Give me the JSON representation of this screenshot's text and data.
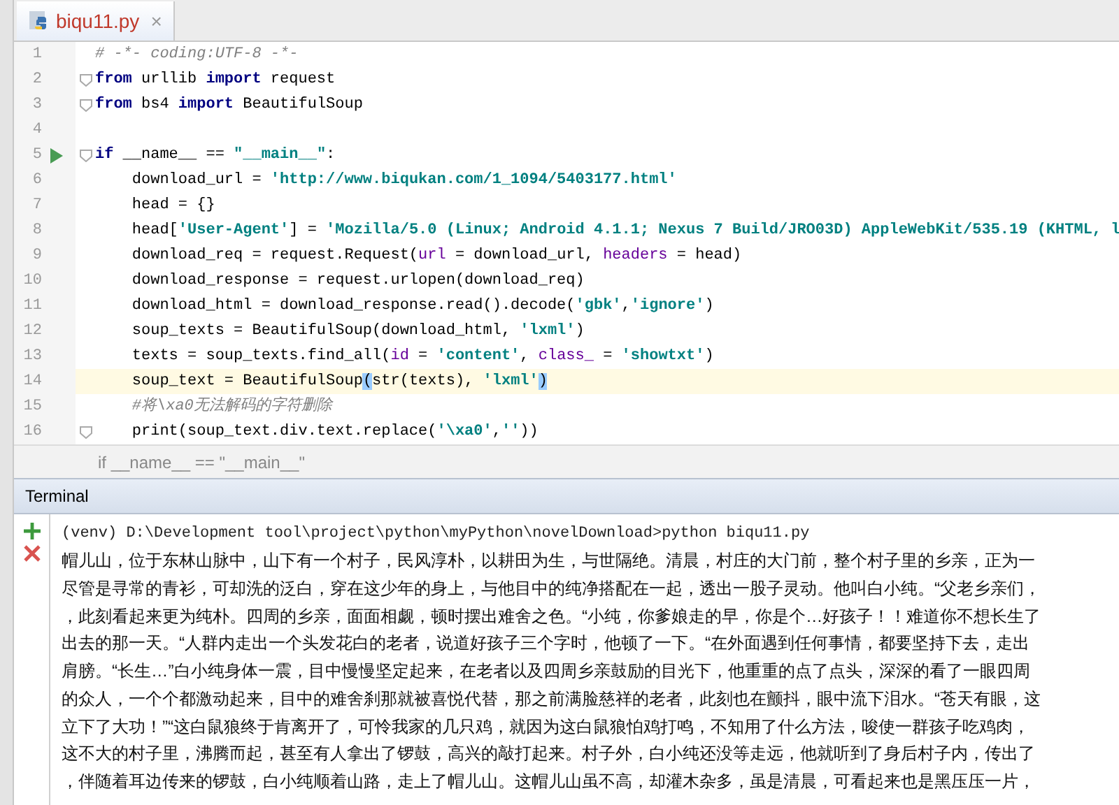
{
  "tab": {
    "title": "biqu11.py",
    "close": "×"
  },
  "code_lines": [
    {
      "number": "1",
      "current": false,
      "run": false,
      "fold": false,
      "tokens": [
        {
          "kind": "cmt",
          "text": "# -*- coding:UTF-8 -*-"
        }
      ]
    },
    {
      "number": "2",
      "current": false,
      "run": false,
      "fold": true,
      "tokens": [
        {
          "kind": "kw",
          "text": "from"
        },
        {
          "kind": "plain",
          "text": " urllib "
        },
        {
          "kind": "kw",
          "text": "import"
        },
        {
          "kind": "plain",
          "text": " request"
        }
      ]
    },
    {
      "number": "3",
      "current": false,
      "run": false,
      "fold": true,
      "tokens": [
        {
          "kind": "kw",
          "text": "from"
        },
        {
          "kind": "plain",
          "text": " bs4 "
        },
        {
          "kind": "kw",
          "text": "import"
        },
        {
          "kind": "plain",
          "text": " BeautifulSoup"
        }
      ]
    },
    {
      "number": "4",
      "current": false,
      "run": false,
      "fold": false
    },
    {
      "number": "5",
      "current": false,
      "run": true,
      "fold": true,
      "tokens": [
        {
          "kind": "kw",
          "text": "if"
        },
        {
          "kind": "plain",
          "text": " __name__ == "
        },
        {
          "kind": "str",
          "text": "\"__main__\""
        },
        {
          "kind": "plain",
          "text": ":"
        }
      ]
    },
    {
      "number": "6",
      "current": false,
      "run": false,
      "fold": false,
      "tokens": [
        {
          "kind": "plain",
          "text": "    download_url = "
        },
        {
          "kind": "str",
          "text": "'http://www.biqukan.com/1_1094/5403177.html'"
        }
      ]
    },
    {
      "number": "7",
      "current": false,
      "run": false,
      "fold": false,
      "tokens": [
        {
          "kind": "plain",
          "text": "    head = {}"
        }
      ]
    },
    {
      "number": "8",
      "current": false,
      "run": false,
      "fold": false,
      "tokens": [
        {
          "kind": "plain",
          "text": "    head["
        },
        {
          "kind": "str",
          "text": "'User-Agent'"
        },
        {
          "kind": "plain",
          "text": "] = "
        },
        {
          "kind": "str",
          "text": "'Mozilla/5.0 (Linux; Android 4.1.1; Nexus 7 Build/JRO03D) AppleWebKit/535.19 (KHTML, l"
        }
      ]
    },
    {
      "number": "9",
      "current": false,
      "run": false,
      "fold": false,
      "tokens": [
        {
          "kind": "plain",
          "text": "    download_req = request.Request("
        },
        {
          "kind": "param",
          "text": "url"
        },
        {
          "kind": "plain",
          "text": " = download_url, "
        },
        {
          "kind": "param",
          "text": "headers"
        },
        {
          "kind": "plain",
          "text": " = head)"
        }
      ]
    },
    {
      "number": "10",
      "current": false,
      "run": false,
      "fold": false,
      "tokens": [
        {
          "kind": "plain",
          "text": "    download_response = request.urlopen(download_req)"
        }
      ]
    },
    {
      "number": "11",
      "current": false,
      "run": false,
      "fold": false,
      "tokens": [
        {
          "kind": "plain",
          "text": "    download_html = download_response.read().decode("
        },
        {
          "kind": "str",
          "text": "'gbk'"
        },
        {
          "kind": "plain",
          "text": ","
        },
        {
          "kind": "str",
          "text": "'ignore'"
        },
        {
          "kind": "plain",
          "text": ")"
        }
      ]
    },
    {
      "number": "12",
      "current": false,
      "run": false,
      "fold": false,
      "tokens": [
        {
          "kind": "plain",
          "text": "    soup_texts = BeautifulSoup(download_html, "
        },
        {
          "kind": "str",
          "text": "'lxml'"
        },
        {
          "kind": "plain",
          "text": ")"
        }
      ]
    },
    {
      "number": "13",
      "current": false,
      "run": false,
      "fold": false,
      "tokens": [
        {
          "kind": "plain",
          "text": "    texts = soup_texts.find_all("
        },
        {
          "kind": "param",
          "text": "id"
        },
        {
          "kind": "plain",
          "text": " = "
        },
        {
          "kind": "str",
          "text": "'content'"
        },
        {
          "kind": "plain",
          "text": ", "
        },
        {
          "kind": "param",
          "text": "class_"
        },
        {
          "kind": "plain",
          "text": " = "
        },
        {
          "kind": "str",
          "text": "'showtxt'"
        },
        {
          "kind": "plain",
          "text": ")"
        }
      ]
    },
    {
      "number": "14",
      "current": true,
      "run": false,
      "fold": false,
      "tokens": [
        {
          "kind": "plain",
          "text": "    soup_text = BeautifulSoup"
        },
        {
          "kind": "match",
          "text": "("
        },
        {
          "kind": "plain",
          "text": "str(texts), "
        },
        {
          "kind": "str",
          "text": "'lxml'"
        },
        {
          "kind": "match",
          "text": ")"
        }
      ]
    },
    {
      "number": "15",
      "current": false,
      "run": false,
      "fold": false,
      "tokens": [
        {
          "kind": "cmt",
          "text": "    #将\\xa0无法解码的字符删除"
        }
      ]
    },
    {
      "number": "16",
      "current": false,
      "run": false,
      "fold": true,
      "tokens": [
        {
          "kind": "plain",
          "text": "    print(soup_text.div.text.replace("
        },
        {
          "kind": "str",
          "text": "'\\xa0'"
        },
        {
          "kind": "plain",
          "text": ","
        },
        {
          "kind": "str",
          "text": "''"
        },
        {
          "kind": "plain",
          "text": "))"
        }
      ]
    }
  ],
  "breadcrumb": "if __name__ == \"__main__\"",
  "terminal": {
    "title": "Terminal",
    "prompt": "(venv) D:\\Development tool\\project\\python\\myPython\\novelDownload>python biqu11.py",
    "output": [
      "帽儿山，位于东林山脉中，山下有一个村子，民风淳朴，以耕田为生，与世隔绝。清晨，村庄的大门前，整个村子里的乡亲，正为一",
      "尽管是寻常的青衫，可却洗的泛白，穿在这少年的身上，与他目中的纯净搭配在一起，透出一股子灵动。他叫白小纯。“父老乡亲们，",
      "，此刻看起来更为纯朴。四周的乡亲，面面相觑，顿时摆出难舍之色。“小纯，你爹娘走的早，你是个…好孩子！！难道你不想长生了",
      "出去的那一天。“人群内走出一个头发花白的老者，说道好孩子三个字时，他顿了一下。“在外面遇到任何事情，都要坚持下去，走出",
      "肩膀。“长生…”白小纯身体一震，目中慢慢坚定起来，在老者以及四周乡亲鼓励的目光下，他重重的点了点头，深深的看了一眼四周",
      "的众人，一个个都激动起来，目中的难舍刹那就被喜悦代替，那之前满脸慈祥的老者，此刻也在颤抖，眼中流下泪水。“苍天有眼，这",
      "立下了大功！”“这白鼠狼终于肯离开了，可怜我家的几只鸡，就因为这白鼠狼怕鸡打鸣，不知用了什么方法，唆使一群孩子吃鸡肉，",
      "这不大的村子里，沸腾而起，甚至有人拿出了锣鼓，高兴的敲打起来。村子外，白小纯还没等走远，他就听到了身后村子内，传出了",
      "，伴随着耳边传来的锣鼓，白小纯顺着山路，走上了帽儿山。这帽儿山虽不高，却灌木杂多，虽是清晨，可看起来也是黑压压一片，"
    ]
  }
}
